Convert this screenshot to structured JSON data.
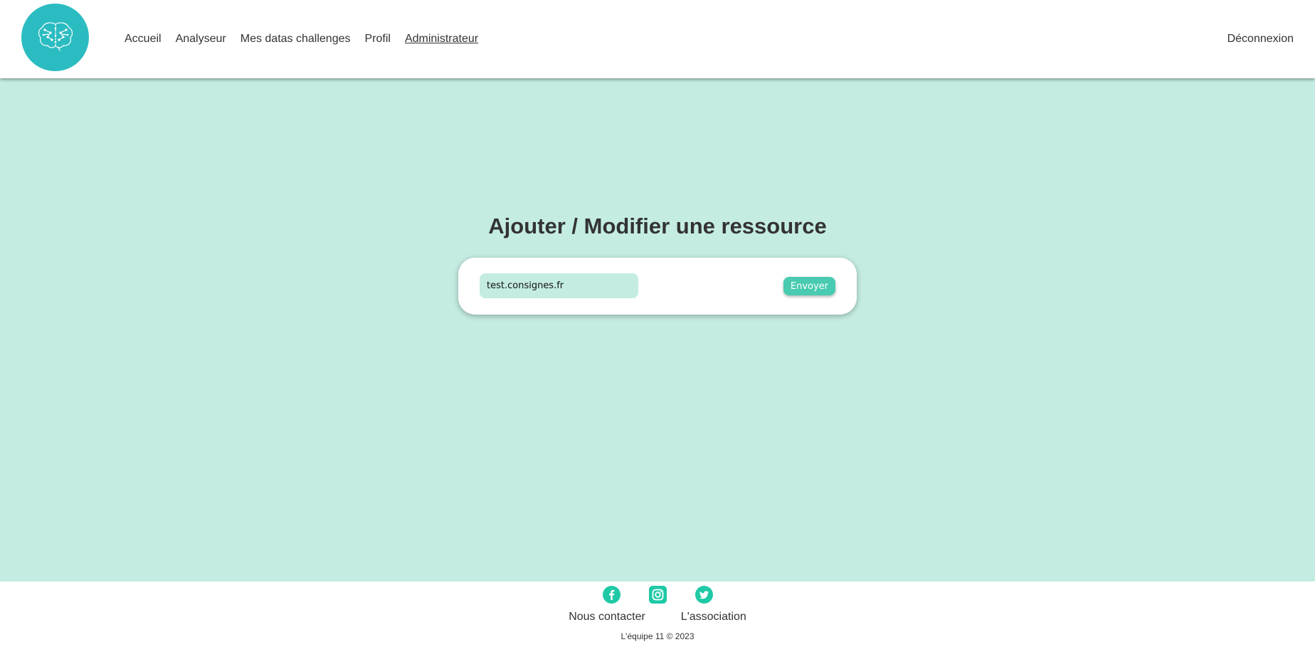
{
  "colors": {
    "brand_teal": "#2bbcc1",
    "background_mint": "#c4ece2",
    "accent_green": "#48cbb0",
    "social_green": "#1fc9a6",
    "text_dark": "#333333"
  },
  "header": {
    "logo_icon": "brain-icon",
    "nav": [
      {
        "label": "Accueil",
        "active": false
      },
      {
        "label": "Analyseur",
        "active": false
      },
      {
        "label": "Mes datas challenges",
        "active": false
      },
      {
        "label": "Profil",
        "active": false
      },
      {
        "label": "Administrateur",
        "active": true
      }
    ],
    "logout_label": "Déconnexion"
  },
  "main": {
    "title": "Ajouter / Modifier une ressource",
    "form": {
      "input_value": "test.consignes.fr",
      "submit_label": "Envoyer"
    }
  },
  "footer": {
    "socials": [
      "facebook-icon",
      "instagram-icon",
      "twitter-icon"
    ],
    "links": [
      "Nous contacter",
      "L'association"
    ],
    "copyright": "L'équipe 11 © 2023"
  }
}
